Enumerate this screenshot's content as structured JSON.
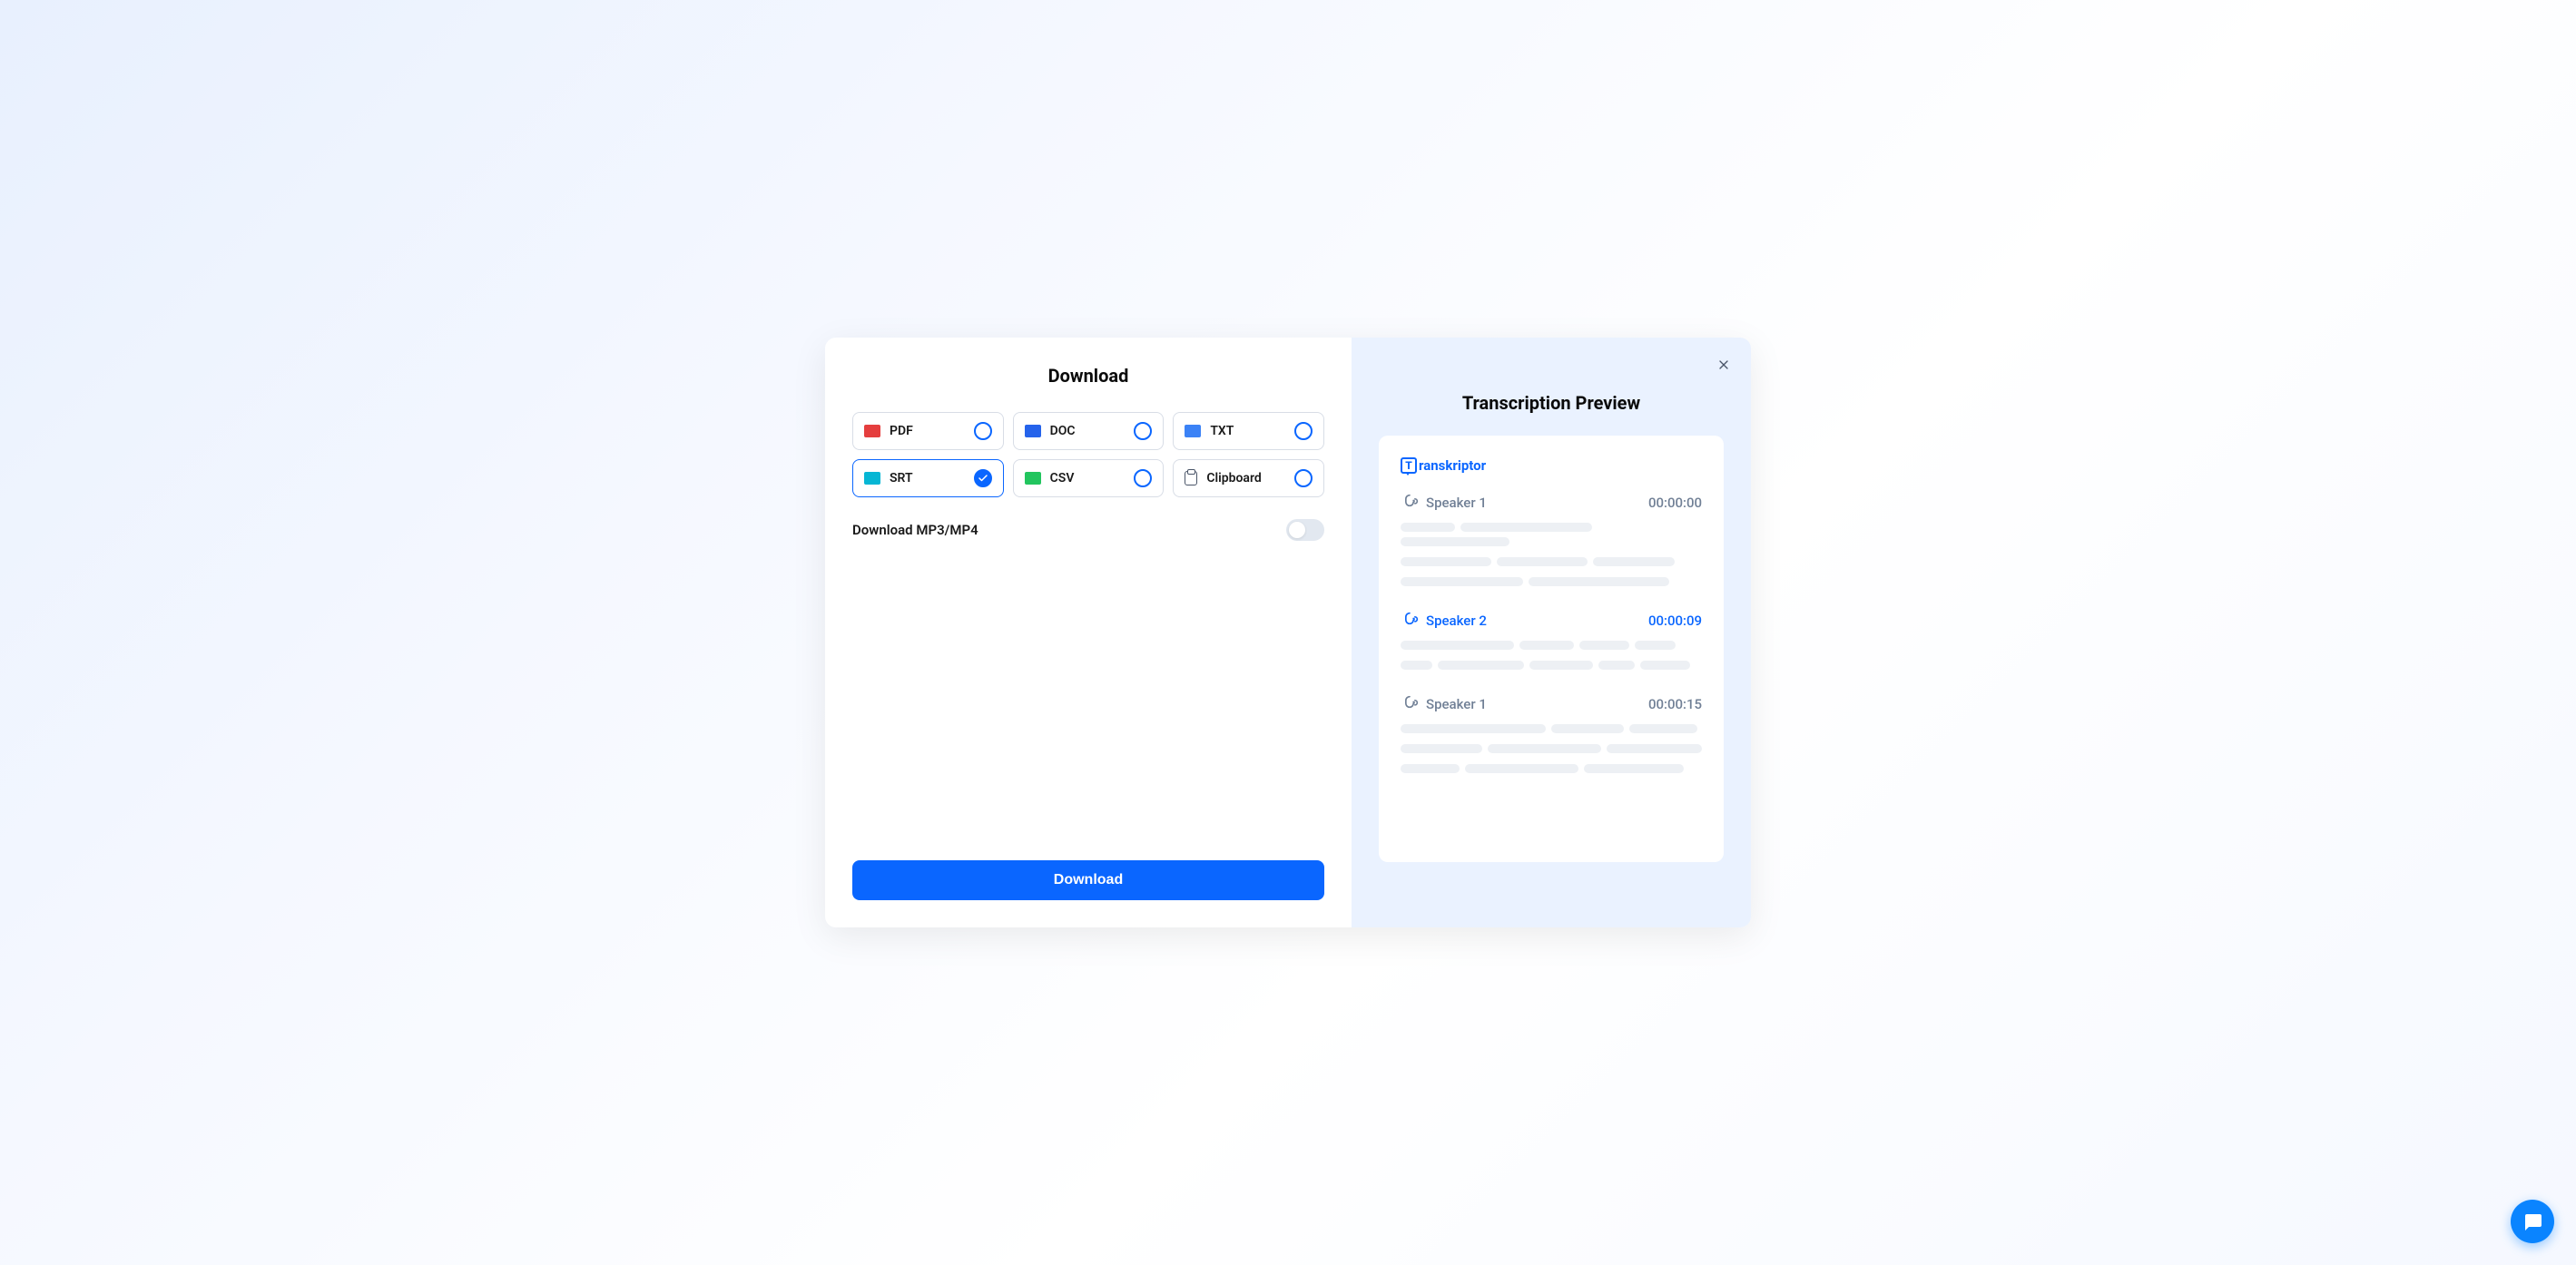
{
  "left": {
    "title": "Download",
    "formats": [
      {
        "key": "pdf",
        "label": "PDF",
        "selected": false
      },
      {
        "key": "doc",
        "label": "DOC",
        "selected": false
      },
      {
        "key": "txt",
        "label": "TXT",
        "selected": false
      },
      {
        "key": "srt",
        "label": "SRT",
        "selected": true
      },
      {
        "key": "csv",
        "label": "CSV",
        "selected": false
      },
      {
        "key": "clipboard",
        "label": "Clipboard",
        "selected": false
      }
    ],
    "toggle_label": "Download MP3/MP4",
    "toggle_on": false,
    "download_button": "Download"
  },
  "right": {
    "title": "Transcription Preview",
    "brand": "ranskriptor",
    "brand_letter": "T",
    "speakers": [
      {
        "name": "Speaker 1",
        "time": "00:00:00",
        "active": false,
        "lines": [
          [
            60,
            145,
            120
          ],
          [
            100,
            100,
            90
          ],
          [
            135,
            155
          ]
        ]
      },
      {
        "name": "Speaker 2",
        "time": "00:00:09",
        "active": true,
        "lines": [
          [
            125,
            60,
            55,
            45
          ],
          [
            35,
            95,
            70,
            40,
            55
          ]
        ]
      },
      {
        "name": "Speaker 1",
        "time": "00:00:15",
        "active": false,
        "lines": [
          [
            160,
            80,
            75
          ],
          [
            90,
            125,
            105
          ],
          [
            65,
            125,
            110
          ]
        ]
      }
    ]
  }
}
